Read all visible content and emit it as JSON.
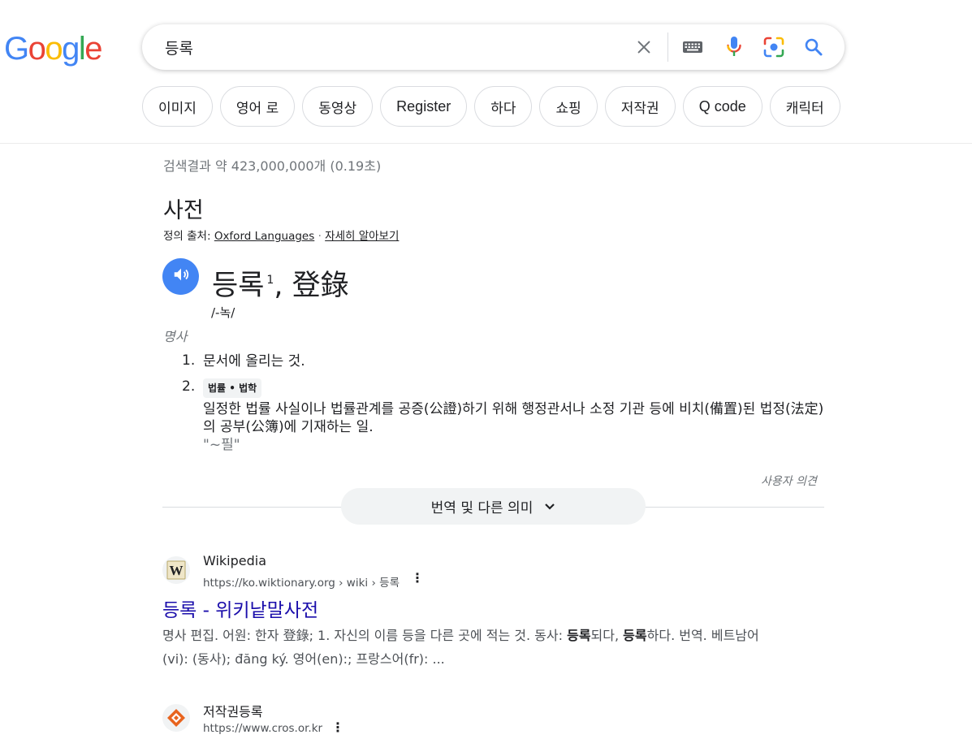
{
  "logo": {
    "letters": [
      "G",
      "o",
      "o",
      "g",
      "l",
      "e"
    ],
    "colors": [
      "#4285F4",
      "#EA4335",
      "#FBBC05",
      "#4285F4",
      "#34A853",
      "#EA4335"
    ]
  },
  "search": {
    "query": "등록",
    "icons": [
      "close-icon",
      "keyboard-icon",
      "mic-icon",
      "lens-icon",
      "search-icon"
    ]
  },
  "chips": [
    "이미지",
    "영어 로",
    "동영상",
    "Register",
    "하다",
    "쇼핑",
    "저작권",
    "Q code",
    "캐릭터"
  ],
  "stats": "검색결과 약 423,000,000개 (0.19초)",
  "dictionary": {
    "title": "사전",
    "source_prefix": "정의 출처: ",
    "source_link": "Oxford Languages",
    "source_sep": " · ",
    "learn_more": "자세히 알아보기",
    "headword": "등록",
    "superscript": "1",
    "hanja": ", 登錄",
    "phonetic": "/-녹/",
    "part_of_speech": "명사",
    "definitions": [
      {
        "num": "1.",
        "tag": "",
        "text": "문서에 올리는 것.",
        "example": ""
      },
      {
        "num": "2.",
        "tag": "법률 • 법학",
        "text": "일정한 법률 사실이나 법률관계를 공증(公證)하기 위해 행정관서나 소정 기관 등에 비치(備置)된 법정(法定)의 공부(公簿)에 기재하는 일.",
        "example": "\"~필\""
      }
    ],
    "feedback": "사용자 의견",
    "more_label": "번역 및 다른 의미"
  },
  "results": [
    {
      "site_name": "Wikipedia",
      "url": "https://ko.wiktionary.org › wiki › 등록",
      "title": "등록 - 위키낱말사전",
      "snippet_parts": [
        {
          "t": "명사 편집. 어원: 한자 登錄; 1. 자신의 이름 등을 다른 곳에 적는 것. 동사: ",
          "b": false
        },
        {
          "t": "등록",
          "b": true
        },
        {
          "t": "되다, ",
          "b": false
        },
        {
          "t": "등록",
          "b": true
        },
        {
          "t": "하다. 번역. 베트남어(vi): (동사); đăng ký. 영어(en):; 프랑스어(fr): ...",
          "b": false
        }
      ]
    },
    {
      "site_name": "저작권등록",
      "url": "https://www.cros.or.kr",
      "title": "",
      "snippet_parts": []
    }
  ],
  "colors": {
    "link": "#1a0dab",
    "accent_blue": "#4285f4",
    "secondary_text": "#70757a"
  }
}
